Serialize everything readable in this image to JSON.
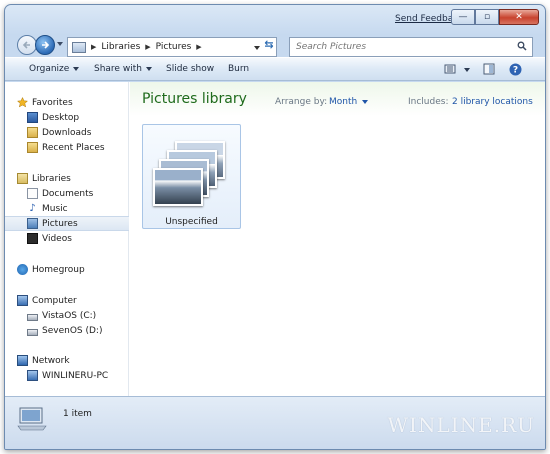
{
  "title_bar": {
    "feedback_link": "Send Feedback",
    "minimize_glyph": "—",
    "maximize_glyph": "▫",
    "close_glyph": "✕"
  },
  "address_bar": {
    "breadcrumbs": [
      "Libraries",
      "Pictures"
    ],
    "search_placeholder": "Search Pictures"
  },
  "toolbar": {
    "organize": "Organize",
    "share_with": "Share with",
    "slide_show": "Slide show",
    "burn": "Burn"
  },
  "nav_pane": {
    "favorites": {
      "label": "Favorites",
      "items": [
        "Desktop",
        "Downloads",
        "Recent Places"
      ]
    },
    "libraries": {
      "label": "Libraries",
      "items": [
        "Documents",
        "Music",
        "Pictures",
        "Videos"
      ],
      "selected": "Pictures"
    },
    "homegroup": {
      "label": "Homegroup"
    },
    "computer": {
      "label": "Computer",
      "items": [
        "VistaOS (C:)",
        "SevenOS (D:)"
      ]
    },
    "network": {
      "label": "Network",
      "items": [
        "WINLINERU-PC"
      ]
    }
  },
  "library": {
    "title": "Pictures library",
    "arrange_label": "Arrange by:",
    "arrange_value": "Month",
    "includes_label": "Includes:",
    "includes_link": "2 library locations"
  },
  "items": [
    {
      "label": "Unspecified"
    }
  ],
  "details": {
    "count_text": "1 item",
    "watermark": "WINLINE.RU"
  },
  "colors": {
    "library_title": "#1f6b1c",
    "link": "#1f55a8",
    "accent_blue": "#2d6bb6"
  }
}
